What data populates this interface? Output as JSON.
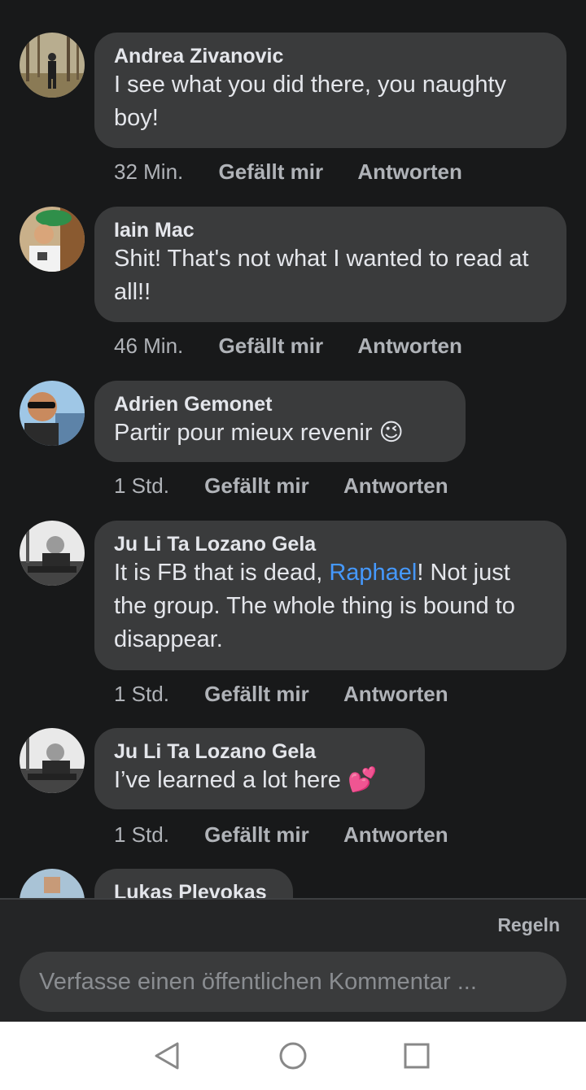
{
  "comments": [
    {
      "author": "Andrea Zivanovic",
      "text": "I see what you did there, you naughty boy!",
      "time": "32 Min.",
      "like_label": "Gefällt mir",
      "reply_label": "Antworten"
    },
    {
      "author": "Iain Mac",
      "text": "Shit! That's not what I wanted to read at all!!",
      "time": "46 Min.",
      "like_label": "Gefällt mir",
      "reply_label": "Antworten"
    },
    {
      "author": "Adrien Gemonet",
      "text": "Partir pour mieux revenir",
      "emoji": "😉",
      "time": "1 Std.",
      "like_label": "Gefällt mir",
      "reply_label": "Antworten"
    },
    {
      "author": "Ju Li Ta Lozano Gela",
      "text_before": "It is FB that is dead, ",
      "mention": "Raphael",
      "text_after": "! Not just the group. The whole thing is bound to disappear.",
      "time": "1 Std.",
      "like_label": "Gefällt mir",
      "reply_label": "Antworten"
    },
    {
      "author": "Ju Li Ta Lozano Gela",
      "text": "I’ve learned a lot here",
      "emoji": "💕",
      "time": "1 Std.",
      "like_label": "Gefällt mir",
      "reply_label": "Antworten"
    },
    {
      "author": "Lukas Plevokas"
    }
  ],
  "footer": {
    "rules_label": "Regeln",
    "composer_placeholder": "Verfasse einen öffentlichen Kommentar ..."
  },
  "colors": {
    "background": "#18191a",
    "bubble": "#3a3b3c",
    "mention": "#4599ff",
    "meta": "#b0b3b8"
  }
}
